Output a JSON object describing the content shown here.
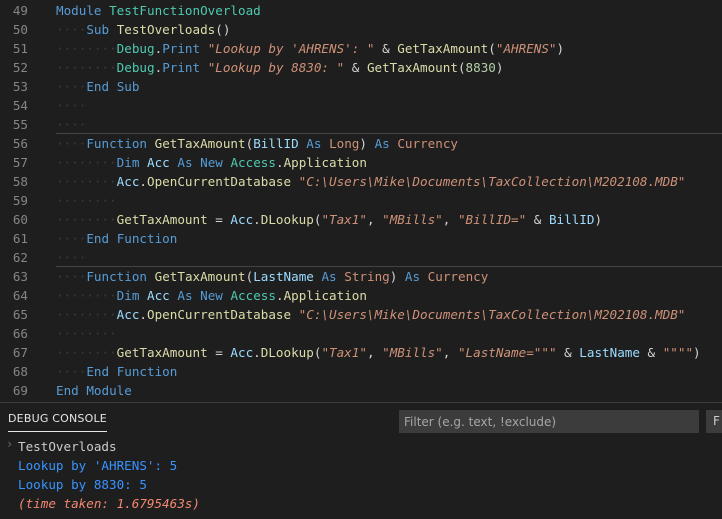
{
  "editor": {
    "lines": [
      {
        "n": "49",
        "tokens": [
          [
            "Module",
            "kw"
          ],
          [
            " ",
            "pn"
          ],
          [
            "TestFunctionOverload",
            "ty"
          ]
        ]
      },
      {
        "n": "50",
        "tokens": [
          [
            "····",
            "ws"
          ],
          [
            "Sub",
            "kw"
          ],
          [
            " ",
            "pn"
          ],
          [
            "TestOverloads",
            "fn"
          ],
          [
            "()",
            "pn"
          ]
        ]
      },
      {
        "n": "51",
        "tokens": [
          [
            "········",
            "ws"
          ],
          [
            "Debug",
            "ty"
          ],
          [
            ".",
            "pn"
          ],
          [
            "Print",
            "kw"
          ],
          [
            " ",
            "pn"
          ],
          [
            "\"Lookup by 'AHRENS': \"",
            "st"
          ],
          [
            " & ",
            "op"
          ],
          [
            "GetTaxAmount",
            "fn"
          ],
          [
            "(",
            "pn"
          ],
          [
            "\"AHRENS\"",
            "st"
          ],
          [
            ")",
            "pn"
          ]
        ]
      },
      {
        "n": "52",
        "tokens": [
          [
            "········",
            "ws"
          ],
          [
            "Debug",
            "ty"
          ],
          [
            ".",
            "pn"
          ],
          [
            "Print",
            "kw"
          ],
          [
            " ",
            "pn"
          ],
          [
            "\"Lookup by 8830: \"",
            "st"
          ],
          [
            " & ",
            "op"
          ],
          [
            "GetTaxAmount",
            "fn"
          ],
          [
            "(",
            "pn"
          ],
          [
            "8830",
            "nm"
          ],
          [
            ")",
            "pn"
          ]
        ]
      },
      {
        "n": "53",
        "tokens": [
          [
            "····",
            "ws"
          ],
          [
            "End",
            "kw"
          ],
          [
            " ",
            "pn"
          ],
          [
            "Sub",
            "kw"
          ]
        ]
      },
      {
        "n": "54",
        "tokens": [
          [
            "····",
            "ws"
          ]
        ]
      },
      {
        "n": "55",
        "tokens": [
          [
            "····",
            "ws"
          ]
        ]
      },
      {
        "n": "56",
        "tokens": [
          [
            "····",
            "ws"
          ],
          [
            "Function",
            "kw"
          ],
          [
            " ",
            "pn"
          ],
          [
            "GetTaxAmount",
            "fn"
          ],
          [
            "(",
            "pn"
          ],
          [
            "BillID",
            "vr"
          ],
          [
            " ",
            "pn"
          ],
          [
            "As",
            "kw"
          ],
          [
            " ",
            "pn"
          ],
          [
            "Long",
            "tc"
          ],
          [
            ") ",
            "pn"
          ],
          [
            "As",
            "kw"
          ],
          [
            " ",
            "pn"
          ],
          [
            "Currency",
            "tc"
          ]
        ],
        "sep": true
      },
      {
        "n": "57",
        "tokens": [
          [
            "········",
            "ws"
          ],
          [
            "Dim",
            "kw"
          ],
          [
            " ",
            "pn"
          ],
          [
            "Acc",
            "vr"
          ],
          [
            " ",
            "pn"
          ],
          [
            "As",
            "kw"
          ],
          [
            " ",
            "pn"
          ],
          [
            "New",
            "kw"
          ],
          [
            " ",
            "pn"
          ],
          [
            "Access",
            "ty"
          ],
          [
            ".",
            "pn"
          ],
          [
            "Application",
            "fn"
          ]
        ]
      },
      {
        "n": "58",
        "tokens": [
          [
            "········",
            "ws"
          ],
          [
            "Acc",
            "vr"
          ],
          [
            ".",
            "pn"
          ],
          [
            "OpenCurrentDatabase",
            "fn"
          ],
          [
            " ",
            "pn"
          ],
          [
            "\"C:\\Users\\Mike\\Documents\\TaxCollection\\M202108.MDB\"",
            "st"
          ]
        ]
      },
      {
        "n": "59",
        "tokens": [
          [
            "········",
            "ws"
          ]
        ]
      },
      {
        "n": "60",
        "tokens": [
          [
            "········",
            "ws"
          ],
          [
            "GetTaxAmount",
            "fn"
          ],
          [
            " = ",
            "op"
          ],
          [
            "Acc",
            "vr"
          ],
          [
            ".",
            "pn"
          ],
          [
            "DLookup",
            "fn"
          ],
          [
            "(",
            "pn"
          ],
          [
            "\"Tax1\"",
            "st"
          ],
          [
            ", ",
            "pn"
          ],
          [
            "\"MBills\"",
            "st"
          ],
          [
            ", ",
            "pn"
          ],
          [
            "\"BillID=\"",
            "st"
          ],
          [
            " & ",
            "op"
          ],
          [
            "BillID",
            "vr"
          ],
          [
            ")",
            "pn"
          ]
        ]
      },
      {
        "n": "61",
        "tokens": [
          [
            "····",
            "ws"
          ],
          [
            "End",
            "kw"
          ],
          [
            " ",
            "pn"
          ],
          [
            "Function",
            "kw"
          ]
        ]
      },
      {
        "n": "62",
        "tokens": [
          [
            "····",
            "ws"
          ]
        ]
      },
      {
        "n": "63",
        "tokens": [
          [
            "····",
            "ws"
          ],
          [
            "Function",
            "kw"
          ],
          [
            " ",
            "pn"
          ],
          [
            "GetTaxAmount",
            "fn"
          ],
          [
            "(",
            "pn"
          ],
          [
            "LastName",
            "vr"
          ],
          [
            " ",
            "pn"
          ],
          [
            "As",
            "kw"
          ],
          [
            " ",
            "pn"
          ],
          [
            "String",
            "tc"
          ],
          [
            ") ",
            "pn"
          ],
          [
            "As",
            "kw"
          ],
          [
            " ",
            "pn"
          ],
          [
            "Currency",
            "tc"
          ]
        ],
        "sep": true
      },
      {
        "n": "64",
        "tokens": [
          [
            "········",
            "ws"
          ],
          [
            "Dim",
            "kw"
          ],
          [
            " ",
            "pn"
          ],
          [
            "Acc",
            "vr"
          ],
          [
            " ",
            "pn"
          ],
          [
            "As",
            "kw"
          ],
          [
            " ",
            "pn"
          ],
          [
            "New",
            "kw"
          ],
          [
            " ",
            "pn"
          ],
          [
            "Access",
            "ty"
          ],
          [
            ".",
            "pn"
          ],
          [
            "Application",
            "fn"
          ]
        ]
      },
      {
        "n": "65",
        "tokens": [
          [
            "········",
            "ws"
          ],
          [
            "Acc",
            "vr"
          ],
          [
            ".",
            "pn"
          ],
          [
            "OpenCurrentDatabase",
            "fn"
          ],
          [
            " ",
            "pn"
          ],
          [
            "\"C:\\Users\\Mike\\Documents\\TaxCollection\\M202108.MDB\"",
            "st"
          ]
        ]
      },
      {
        "n": "66",
        "tokens": [
          [
            "········",
            "ws"
          ]
        ]
      },
      {
        "n": "67",
        "tokens": [
          [
            "········",
            "ws"
          ],
          [
            "GetTaxAmount",
            "fn"
          ],
          [
            " = ",
            "op"
          ],
          [
            "Acc",
            "vr"
          ],
          [
            ".",
            "pn"
          ],
          [
            "DLookup",
            "fn"
          ],
          [
            "(",
            "pn"
          ],
          [
            "\"Tax1\"",
            "st"
          ],
          [
            ", ",
            "pn"
          ],
          [
            "\"MBills\"",
            "st"
          ],
          [
            ", ",
            "pn"
          ],
          [
            "\"LastName=\"\"\"",
            "st"
          ],
          [
            " & ",
            "op"
          ],
          [
            "LastName",
            "vr"
          ],
          [
            " & ",
            "op"
          ],
          [
            "\"\"\"\"",
            "st"
          ],
          [
            ")",
            "pn"
          ]
        ]
      },
      {
        "n": "68",
        "tokens": [
          [
            "····",
            "ws"
          ],
          [
            "End",
            "kw"
          ],
          [
            " ",
            "pn"
          ],
          [
            "Function",
            "kw"
          ]
        ]
      },
      {
        "n": "69",
        "tokens": [
          [
            "End",
            "kw"
          ],
          [
            " ",
            "pn"
          ],
          [
            "Module",
            "kw"
          ]
        ]
      }
    ]
  },
  "panel": {
    "tab_label": "DEBUG CONSOLE",
    "filter_placeholder": "Filter (e.g. text, !exclude)",
    "more_label": "F",
    "output": [
      {
        "text": "TestOverloads",
        "color": "#cccccc"
      },
      {
        "text": "Lookup by 'AHRENS': 5",
        "color": "#3794ff"
      },
      {
        "text": "Lookup by 8830: 5",
        "color": "#3794ff"
      },
      {
        "text": "(time taken: 1.6795463s)",
        "color": "#f48771",
        "italic": true
      }
    ]
  }
}
